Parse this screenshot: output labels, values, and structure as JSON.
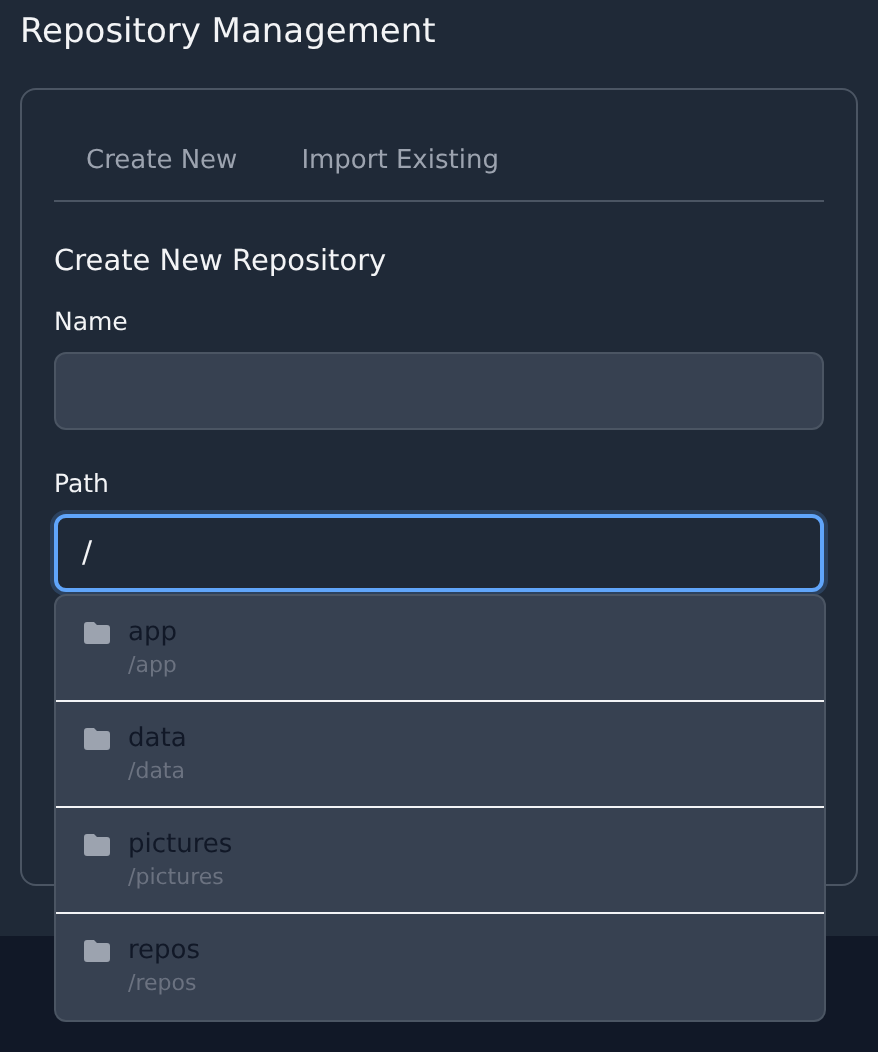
{
  "header": {
    "title": "Repository Management"
  },
  "tabs": [
    {
      "label": "Create New",
      "selected": false
    },
    {
      "label": "Import Existing",
      "selected": false
    }
  ],
  "form": {
    "heading": "Create New Repository",
    "fields": [
      {
        "label": "Name",
        "focused": false
      },
      {
        "label": "Path",
        "value": "/",
        "focused": true
      }
    ]
  },
  "suggestions": [
    {
      "name": "app",
      "path": "/app"
    },
    {
      "name": "data",
      "path": "/data"
    },
    {
      "name": "pictures",
      "path": "/pictures"
    },
    {
      "name": "repos",
      "path": "/repos"
    }
  ]
}
